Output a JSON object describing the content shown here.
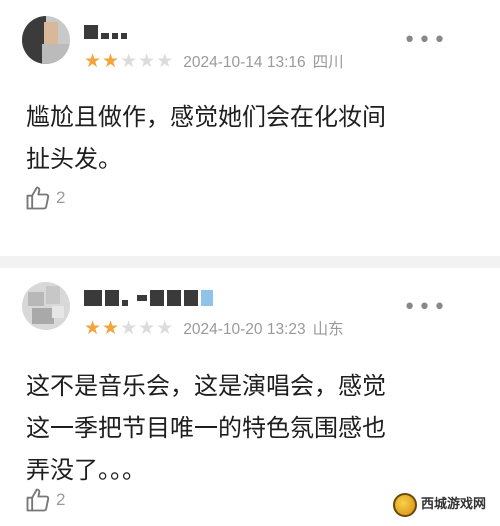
{
  "comments": [
    {
      "rating": 2,
      "max_rating": 5,
      "date": "2024-10-14 13:16",
      "location": "四川",
      "content_lines": [
        "尴尬且做作，感觉她们会在化妆间",
        "扯头发。"
      ],
      "likes": "2",
      "more_label": "•••"
    },
    {
      "rating": 2,
      "max_rating": 5,
      "date": "2024-10-20 13:23",
      "location": "山东",
      "content_lines": [
        "这不是音乐会，这是演唱会，感觉",
        "这一季把节目唯一的特色氛围感也",
        "弄没了。。。"
      ],
      "likes": "2",
      "more_label": "•••"
    }
  ],
  "watermark": {
    "main": "西城游戏网"
  },
  "colors": {
    "star_on": "#f3a53c",
    "star_off": "#dcdcdc",
    "meta": "#9a9a9a"
  },
  "icons": {
    "like": "thumbs-up-icon",
    "more": "more-dots-icon"
  }
}
